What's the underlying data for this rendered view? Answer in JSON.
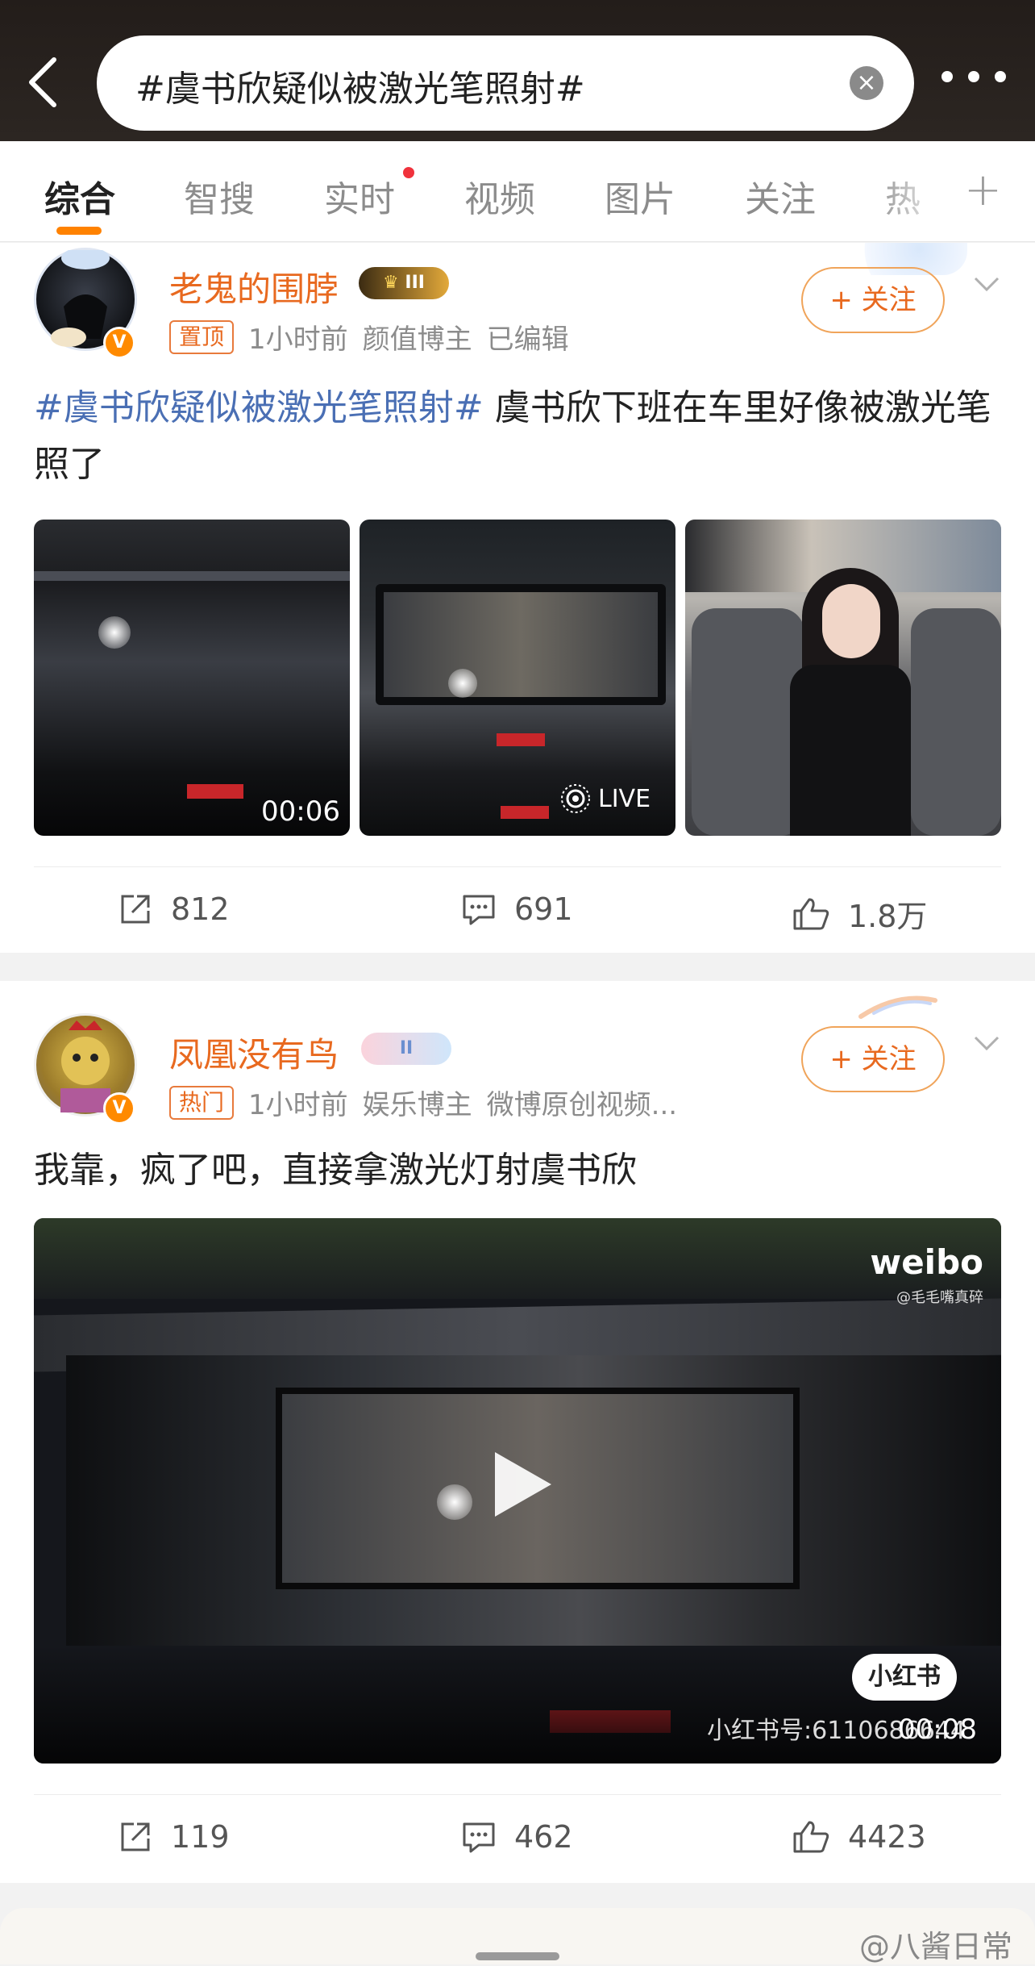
{
  "header": {
    "search_query": "#虞书欣疑似被激光笔照射#",
    "clear_symbol": "×"
  },
  "tabs": [
    {
      "label": "综合",
      "active": true
    },
    {
      "label": "智搜"
    },
    {
      "label": "实时",
      "has_red_dot": true
    },
    {
      "label": "视频"
    },
    {
      "label": "图片"
    },
    {
      "label": "关注"
    },
    {
      "label": "热"
    }
  ],
  "tabs_plus": "+",
  "posts": [
    {
      "username": "老鬼的围脖",
      "level_badge": "III",
      "tag": "置顶",
      "time": "1小时前",
      "role": "颜值博主",
      "edited": "已编辑",
      "follow_label": "+ 关注",
      "topic": "#虞书欣疑似被激光笔照射#",
      "text": " 虞书欣下班在车里好像被激光笔照了",
      "media": [
        {
          "type": "video",
          "duration": "00:06"
        },
        {
          "type": "live",
          "label": "LIVE"
        },
        {
          "type": "image"
        }
      ],
      "reposts": "812",
      "comments": "691",
      "likes": "1.8万"
    },
    {
      "username": "凤凰没有鸟",
      "level_badge": "II",
      "tag": "热门",
      "time": "1小时前",
      "role": "娱乐博主",
      "extra": "微博原创视频...",
      "follow_label": "+ 关注",
      "text": "我靠，疯了吧，直接拿激光灯射虞书欣",
      "video": {
        "watermark": "weibo",
        "handle": "@毛毛嘴真碎",
        "xhs_badge": "小红书",
        "xhs_id": "小红书号:6110686644",
        "duration": "00:08"
      },
      "reposts": "119",
      "comments": "462",
      "likes": "4423"
    }
  ],
  "watermark": "@八酱日常",
  "colors": {
    "accent": "#ff8200",
    "username": "#e8691f",
    "topic": "#4a6fb4"
  }
}
